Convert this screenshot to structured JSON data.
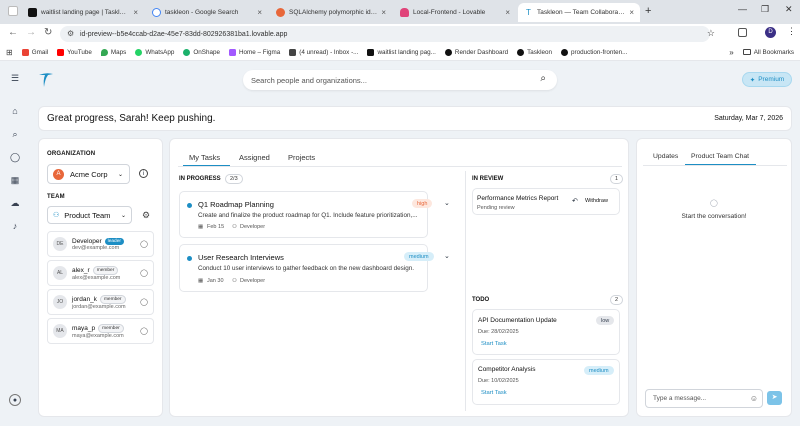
{
  "browser": {
    "tabs": [
      {
        "title": "waitlist landing page | Taskleon",
        "color": "#111111"
      },
      {
        "title": "taskleon - Google Search",
        "color": "#4285f4"
      },
      {
        "title": "SQLAlchemy polymorphic iden",
        "color": "#e8673a"
      },
      {
        "title": "Local-Frontend - Lovable",
        "color": "#e0447a"
      },
      {
        "title": "Taskleon — Team Collaboration",
        "color": "#1d8ec4"
      }
    ],
    "url": "id-preview--b5e4ccab-d2ae-45e7-83dd-802926381ba1.lovable.app",
    "profile_initial": "D",
    "bookmarks": [
      {
        "label": "Gmail",
        "color": "#ea4335"
      },
      {
        "label": "YouTube",
        "color": "#ff0000"
      },
      {
        "label": "Maps",
        "color": "#34a853"
      },
      {
        "label": "WhatsApp",
        "color": "#25d366"
      },
      {
        "label": "OnShape",
        "color": "#1bb16b"
      },
      {
        "label": "Home – Figma",
        "color": "#a259ff"
      },
      {
        "label": "(4 unread) - Inbox -...",
        "color": "#444444"
      },
      {
        "label": "waitlist landing pag...",
        "color": "#111111"
      },
      {
        "label": "Render Dashboard",
        "color": "#111111"
      },
      {
        "label": "Taskleon",
        "color": "#111111"
      },
      {
        "label": "production-fronten...",
        "color": "#111111"
      }
    ],
    "all_bookmarks": "All Bookmarks"
  },
  "app": {
    "search_placeholder": "Search people and organizations...",
    "premium_label": "Premium",
    "greeting": "Great progress, Sarah! Keep pushing.",
    "date": "Saturday, Mar 7, 2026"
  },
  "left": {
    "org_label": "ORGANIZATION",
    "org_name": "Acme Corp",
    "org_initial": "A",
    "team_label": "TEAM",
    "team_name": "Product Team",
    "members": [
      {
        "initials": "DE",
        "name": "Developer",
        "email": "dev@example.com",
        "role": "leader"
      },
      {
        "initials": "AL",
        "name": "alex_r",
        "email": "alex@example.com",
        "role": "member"
      },
      {
        "initials": "JO",
        "name": "jordan_k",
        "email": "jordan@example.com",
        "role": "member"
      },
      {
        "initials": "MA",
        "name": "maya_p",
        "email": "maya@example.com",
        "role": "member"
      }
    ]
  },
  "mid": {
    "tabs": [
      "My Tasks",
      "Assigned",
      "Projects"
    ],
    "in_progress": {
      "title": "IN PROGRESS",
      "count": "2/3",
      "tasks": [
        {
          "title": "Q1 Roadmap Planning",
          "desc": "Create and finalize the product roadmap for Q1. Include feature prioritization,...",
          "priority": "high",
          "date": "Feb 15",
          "assignee": "Developer"
        },
        {
          "title": "User Research Interviews",
          "desc": "Conduct 10 user interviews to gather feedback on the new dashboard design.",
          "priority": "medium",
          "date": "Jan 30",
          "assignee": "Developer"
        }
      ]
    },
    "in_review": {
      "title": "IN REVIEW",
      "count": "1",
      "tasks": [
        {
          "title": "Performance Metrics Report",
          "status": "Pending review",
          "action": "Withdraw"
        }
      ]
    },
    "todo": {
      "title": "TODO",
      "count": "2",
      "tasks": [
        {
          "title": "API Documentation Update",
          "due": "Due: 28/02/2025",
          "priority": "low",
          "action": "Start Task"
        },
        {
          "title": "Competitor Analysis",
          "due": "Due: 10/02/2025",
          "priority": "medium",
          "action": "Start Task"
        }
      ]
    }
  },
  "right": {
    "tabs": [
      "Updates",
      "Product Team Chat"
    ],
    "empty": "Start the conversation!",
    "input_placeholder": "Type a message..."
  },
  "colors": {
    "accent": "#1d8ec4",
    "high": "#e8673a",
    "medium": "#1d8ec4",
    "low": "#374151"
  }
}
